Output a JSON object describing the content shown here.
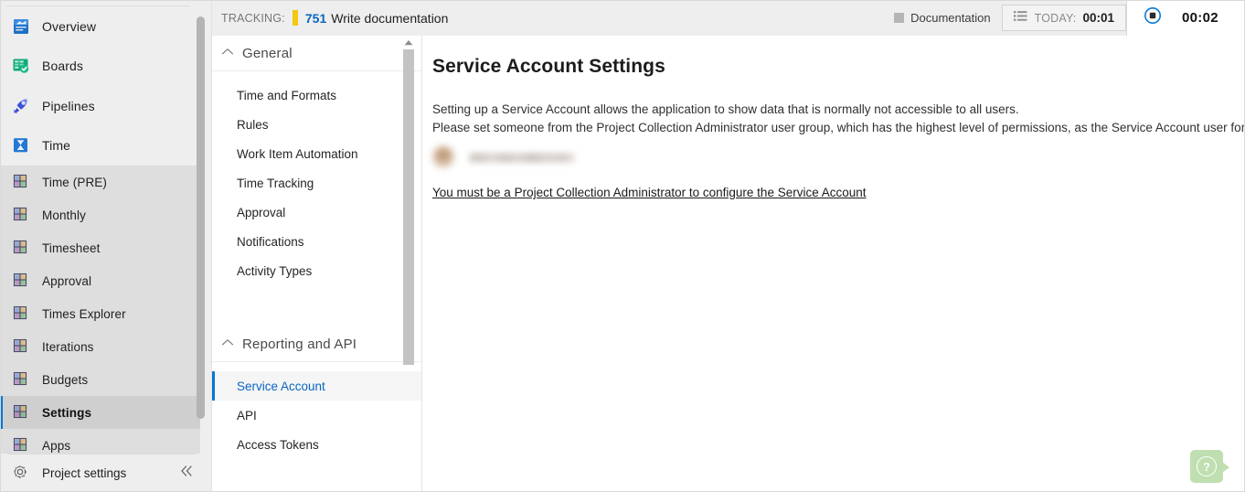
{
  "sidebar": {
    "primary_items": [
      {
        "label": "Overview",
        "icon": "overview-icon"
      },
      {
        "label": "Boards",
        "icon": "boards-icon"
      },
      {
        "label": "Pipelines",
        "icon": "pipelines-icon"
      },
      {
        "label": "Time",
        "icon": "time-hourglass-icon"
      }
    ],
    "extension_items": [
      {
        "label": "Time (PRE)",
        "icon": "grid-icon",
        "selected": false
      },
      {
        "label": "Monthly",
        "icon": "grid-icon",
        "selected": false
      },
      {
        "label": "Timesheet",
        "icon": "grid-icon",
        "selected": false
      },
      {
        "label": "Approval",
        "icon": "grid-icon",
        "selected": false
      },
      {
        "label": "Times Explorer",
        "icon": "grid-icon",
        "selected": false
      },
      {
        "label": "Iterations",
        "icon": "grid-icon",
        "selected": false
      },
      {
        "label": "Budgets",
        "icon": "grid-icon",
        "selected": false
      },
      {
        "label": "Settings",
        "icon": "grid-icon",
        "selected": true
      },
      {
        "label": "Apps",
        "icon": "grid-icon",
        "selected": false
      }
    ],
    "footer": {
      "label": "Project settings",
      "icon": "gear-icon",
      "collapse_icon": "chevron-double-left-icon"
    }
  },
  "topbar": {
    "tracking_label": "TRACKING:",
    "tracking_color": "#f2c811",
    "work_item_id": "751",
    "work_item_title": "Write documentation",
    "documentation_chip": {
      "label": "Documentation",
      "swatch_color": "#b5b5b5"
    },
    "today_chip": {
      "icon": "list-icon",
      "label": "TODAY:",
      "value": "00:01"
    },
    "timer_chip": {
      "icon": "stop-record-icon",
      "value": "00:02"
    }
  },
  "settings_nav": {
    "groups": [
      {
        "title": "General",
        "collapse_icon": "chevron-up-icon",
        "items": [
          {
            "label": "Time and Formats",
            "selected": false
          },
          {
            "label": "Rules",
            "selected": false
          },
          {
            "label": "Work Item Automation",
            "selected": false
          },
          {
            "label": "Time Tracking",
            "selected": false
          },
          {
            "label": "Approval",
            "selected": false
          },
          {
            "label": "Notifications",
            "selected": false
          },
          {
            "label": "Activity Types",
            "selected": false
          }
        ]
      },
      {
        "title": "Reporting and API",
        "collapse_icon": "chevron-up-icon",
        "items": [
          {
            "label": "Service Account",
            "selected": true
          },
          {
            "label": "API",
            "selected": false
          },
          {
            "label": "Access Tokens",
            "selected": false
          }
        ]
      }
    ]
  },
  "content": {
    "title": "Service Account Settings",
    "description_line1": "Setting up a Service Account allows the application to show data that is normally not accessible to all users.",
    "description_line2": "Please set someone from the Project Collection Administrator user group, which has the highest level of permissions, as the Service Account user for your team.",
    "selected_user": {
      "avatar": "user-avatar-blurred",
      "name_redacted": true
    },
    "permission_notice": "You must be a Project Collection Administrator to configure the Service Account"
  },
  "help": {
    "icon": "question-mark-icon",
    "color": "#bfdfb0"
  }
}
